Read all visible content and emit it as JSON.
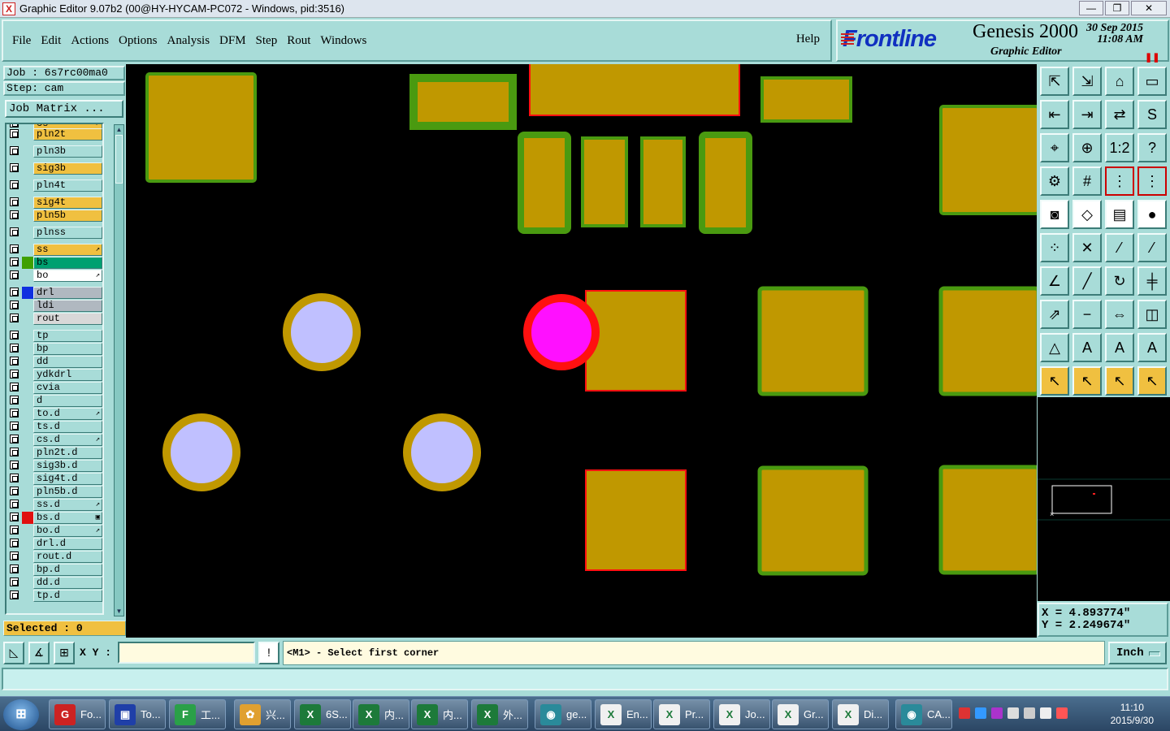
{
  "window": {
    "title": "Graphic Editor 9.07b2 (00@HY-HYCAM-PC072 - Windows, pid:3516)",
    "buttons": [
      "—",
      "❐",
      "✕"
    ]
  },
  "menu": {
    "items": [
      "File",
      "Edit",
      "Actions",
      "Options",
      "Analysis",
      "DFM",
      "Step",
      "Rout",
      "Windows"
    ],
    "help": "Help"
  },
  "logo": {
    "brand": "Frontline",
    "product": "Genesis 2000",
    "subtitle": "Graphic Editor",
    "date": "30 Sep 2015",
    "time": "11:08 AM"
  },
  "job": {
    "job_label": "Job : 6s7rc00ma0",
    "step_label": "Step: cam",
    "matrix_button": "Job Matrix ...",
    "selected": "Selected : 0"
  },
  "layers": [
    {
      "name": "cs",
      "bg": "#f0c040",
      "swatch": "",
      "mark": "↗"
    },
    {
      "name": "pln2t",
      "bg": "#f0c040",
      "swatch": "",
      "mark": ""
    },
    {
      "name": "pln3b",
      "bg": "#a8dcd8",
      "swatch": "",
      "mark": ""
    },
    {
      "name": "sig3b",
      "bg": "#f0c040",
      "swatch": "",
      "mark": ""
    },
    {
      "name": "pln4t",
      "bg": "#a8dcd8",
      "swatch": "",
      "mark": ""
    },
    {
      "name": "sig4t",
      "bg": "#f0c040",
      "swatch": "",
      "mark": ""
    },
    {
      "name": "pln5b",
      "bg": "#f0c040",
      "swatch": "",
      "mark": ""
    },
    {
      "name": "plnss",
      "bg": "#a8dcd8",
      "swatch": "",
      "mark": ""
    },
    {
      "name": "ss",
      "bg": "#f0c040",
      "swatch": "",
      "mark": "↗"
    },
    {
      "name": "bs",
      "bg": "#00a070",
      "swatch": "#40a000",
      "mark": ""
    },
    {
      "name": "bo",
      "bg": "#ffffff",
      "swatch": "",
      "mark": "↗"
    },
    {
      "name": "drl",
      "bg": "#b0b8c0",
      "swatch": "#1030e0",
      "mark": ""
    },
    {
      "name": "ldi",
      "bg": "#b0b8c0",
      "swatch": "",
      "mark": ""
    },
    {
      "name": "rout",
      "bg": "#d8d8d8",
      "swatch": "",
      "mark": ""
    },
    {
      "name": "tp",
      "bg": "#a8dcd8",
      "swatch": "",
      "mark": ""
    },
    {
      "name": "bp",
      "bg": "#a8dcd8",
      "swatch": "",
      "mark": ""
    },
    {
      "name": "dd",
      "bg": "#a8dcd8",
      "swatch": "",
      "mark": ""
    },
    {
      "name": "ydkdrl",
      "bg": "#a8dcd8",
      "swatch": "",
      "mark": ""
    },
    {
      "name": "cvia",
      "bg": "#a8dcd8",
      "swatch": "",
      "mark": ""
    },
    {
      "name": "d",
      "bg": "#a8dcd8",
      "swatch": "",
      "mark": ""
    },
    {
      "name": "to.d",
      "bg": "#a8dcd8",
      "swatch": "",
      "mark": "↗"
    },
    {
      "name": "ts.d",
      "bg": "#a8dcd8",
      "swatch": "",
      "mark": ""
    },
    {
      "name": "cs.d",
      "bg": "#a8dcd8",
      "swatch": "",
      "mark": "↗"
    },
    {
      "name": "pln2t.d",
      "bg": "#a8dcd8",
      "swatch": "",
      "mark": ""
    },
    {
      "name": "sig3b.d",
      "bg": "#a8dcd8",
      "swatch": "",
      "mark": ""
    },
    {
      "name": "sig4t.d",
      "bg": "#a8dcd8",
      "swatch": "",
      "mark": ""
    },
    {
      "name": "pln5b.d",
      "bg": "#a8dcd8",
      "swatch": "",
      "mark": ""
    },
    {
      "name": "ss.d",
      "bg": "#a8dcd8",
      "swatch": "",
      "mark": "↗"
    },
    {
      "name": "bs.d",
      "bg": "#a8dcd8",
      "swatch": "#e01010",
      "mark": "▣"
    },
    {
      "name": "bo.d",
      "bg": "#a8dcd8",
      "swatch": "",
      "mark": "↗"
    },
    {
      "name": "drl.d",
      "bg": "#a8dcd8",
      "swatch": "",
      "mark": ""
    },
    {
      "name": "rout.d",
      "bg": "#a8dcd8",
      "swatch": "",
      "mark": ""
    },
    {
      "name": "bp.d",
      "bg": "#a8dcd8",
      "swatch": "",
      "mark": ""
    },
    {
      "name": "dd.d",
      "bg": "#a8dcd8",
      "swatch": "",
      "mark": ""
    },
    {
      "name": "tp.d",
      "bg": "#a8dcd8",
      "swatch": "",
      "mark": ""
    }
  ],
  "tools": [
    {
      "icon": "zoom-home-icon",
      "glyph": "⇱",
      "style": ""
    },
    {
      "icon": "zoom-back-icon",
      "glyph": "⇲",
      "style": ""
    },
    {
      "icon": "home-view-icon",
      "glyph": "⌂",
      "style": ""
    },
    {
      "icon": "window-view-icon",
      "glyph": "▭",
      "style": ""
    },
    {
      "icon": "pan-left-icon",
      "glyph": "⇤",
      "style": ""
    },
    {
      "icon": "pan-right-icon",
      "glyph": "⇥",
      "style": ""
    },
    {
      "icon": "pan-icon",
      "glyph": "⇄",
      "style": ""
    },
    {
      "icon": "snap-icon",
      "glyph": "S",
      "style": ""
    },
    {
      "icon": "fit-icon",
      "glyph": "⌖",
      "style": ""
    },
    {
      "icon": "center-icon",
      "glyph": "⊕",
      "style": ""
    },
    {
      "icon": "scale-icon",
      "glyph": "1:2",
      "style": ""
    },
    {
      "icon": "help-icon",
      "glyph": "?",
      "style": ""
    },
    {
      "icon": "measure-icon",
      "glyph": "⚙",
      "style": ""
    },
    {
      "icon": "grid-icon",
      "glyph": "#",
      "style": ""
    },
    {
      "icon": "layer-red-icon",
      "glyph": "⋮",
      "style": "r"
    },
    {
      "icon": "layer-red2-icon",
      "glyph": "⋮",
      "style": "r"
    },
    {
      "icon": "camera-icon",
      "glyph": "◙",
      "style": "w"
    },
    {
      "icon": "copy-shape-icon",
      "glyph": "◇",
      "style": "w"
    },
    {
      "icon": "ruler-icon",
      "glyph": "▤",
      "style": "w"
    },
    {
      "icon": "pad-icon",
      "glyph": "●",
      "style": "w"
    },
    {
      "icon": "connect-icon",
      "glyph": "⁘",
      "style": ""
    },
    {
      "icon": "cross-icon",
      "glyph": "✕",
      "style": ""
    },
    {
      "icon": "line-pt-icon",
      "glyph": "⁄",
      "style": ""
    },
    {
      "icon": "line-pt2-icon",
      "glyph": "⁄",
      "style": ""
    },
    {
      "icon": "angle-icon",
      "glyph": "∠",
      "style": ""
    },
    {
      "icon": "slash-icon",
      "glyph": "╱",
      "style": ""
    },
    {
      "icon": "arc-icon",
      "glyph": "↻",
      "style": ""
    },
    {
      "icon": "fan-icon",
      "glyph": "╪",
      "style": ""
    },
    {
      "icon": "move-icon",
      "glyph": "⇗",
      "style": ""
    },
    {
      "icon": "minus-icon",
      "glyph": "−",
      "style": ""
    },
    {
      "icon": "stretch-icon",
      "glyph": "⇔",
      "style": ""
    },
    {
      "icon": "shapes-icon",
      "glyph": "◫",
      "style": ""
    },
    {
      "icon": "triangle-icon",
      "glyph": "△",
      "style": ""
    },
    {
      "icon": "a-icon",
      "glyph": "A",
      "style": ""
    },
    {
      "icon": "a2-icon",
      "glyph": "A",
      "style": ""
    },
    {
      "icon": "a3-icon",
      "glyph": "A",
      "style": ""
    },
    {
      "icon": "pointer-icon",
      "glyph": "↖",
      "style": "y"
    },
    {
      "icon": "pointer-box-icon",
      "glyph": "↖",
      "style": "y"
    },
    {
      "icon": "pointer-circle-icon",
      "glyph": "↖",
      "style": "y"
    },
    {
      "icon": "pointer-path-icon",
      "glyph": "↖",
      "style": "y"
    }
  ],
  "coords": {
    "x": "X = 4.893774\"",
    "y": "Y = 2.249674\""
  },
  "bottom": {
    "xy_label": "X Y :",
    "xy_value": "",
    "message": "<M1> - Select first corner",
    "units": "Inch"
  },
  "colors": {
    "pad": "#c09800",
    "soldermask": "#4a9a10",
    "highlight": "#ff1010",
    "drill": "#c0c0ff",
    "selected_drill": "#ff10ff",
    "panel": "#a8dcd8"
  },
  "taskbar": {
    "items": [
      {
        "label": "Fo...",
        "icon_bg": "#cc2222",
        "glyph": "G"
      },
      {
        "label": "To...",
        "icon_bg": "#1f3fa8",
        "glyph": "▣"
      },
      {
        "label": "工...",
        "icon_bg": "#2aa048",
        "glyph": "F"
      },
      {
        "label": "兴...",
        "icon_bg": "#e0a030",
        "glyph": "✿"
      },
      {
        "label": "6S...",
        "icon_bg": "#1d7a3a",
        "glyph": "X"
      },
      {
        "label": "内...",
        "icon_bg": "#1d7a3a",
        "glyph": "X"
      },
      {
        "label": "内...",
        "icon_bg": "#1d7a3a",
        "glyph": "X"
      },
      {
        "label": "外...",
        "icon_bg": "#1d7a3a",
        "glyph": "X"
      },
      {
        "label": "ge...",
        "icon_bg": "#2a8a9a",
        "glyph": "◉"
      },
      {
        "label": "En...",
        "icon_bg": "#f0f0f0",
        "glyph": "X"
      },
      {
        "label": "Pr...",
        "icon_bg": "#f0f0f0",
        "glyph": "X"
      },
      {
        "label": "Jo...",
        "icon_bg": "#f0f0f0",
        "glyph": "X"
      },
      {
        "label": "Gr...",
        "icon_bg": "#f0f0f0",
        "glyph": "X"
      },
      {
        "label": "Di...",
        "icon_bg": "#f0f0f0",
        "glyph": "X"
      },
      {
        "label": "CA...",
        "icon_bg": "#2a8a9a",
        "glyph": "◉"
      }
    ],
    "time": "11:10",
    "date": "2015/9/30"
  }
}
